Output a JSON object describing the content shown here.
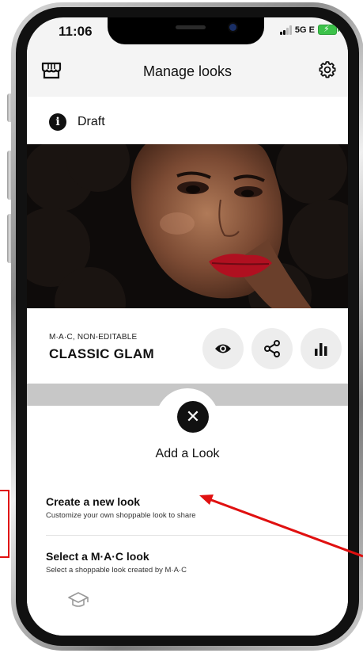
{
  "status_bar": {
    "time": "11:06",
    "network": "5G E"
  },
  "header": {
    "title": "Manage looks",
    "left_icon": "store-icon",
    "right_icon": "gear-icon"
  },
  "draft": {
    "label": "Draft",
    "icon": "info-icon"
  },
  "look": {
    "brand": "M·A·C, NON-EDITABLE",
    "name": "CLASSIC GLAM",
    "actions": [
      "eye-icon",
      "share-icon",
      "bar-chart-icon"
    ]
  },
  "sheet": {
    "title": "Add a Look",
    "close_symbol": "✕",
    "options": [
      {
        "title": "Create a new look",
        "desc": "Customize your own shoppable look to share"
      },
      {
        "title": "Select a M·A·C look",
        "desc": "Select a shoppable look created by M·A·C"
      }
    ],
    "bottom_icon": "graduation-cap-icon"
  },
  "colors": {
    "annotation": "#e01010",
    "lips": "#b01020"
  }
}
